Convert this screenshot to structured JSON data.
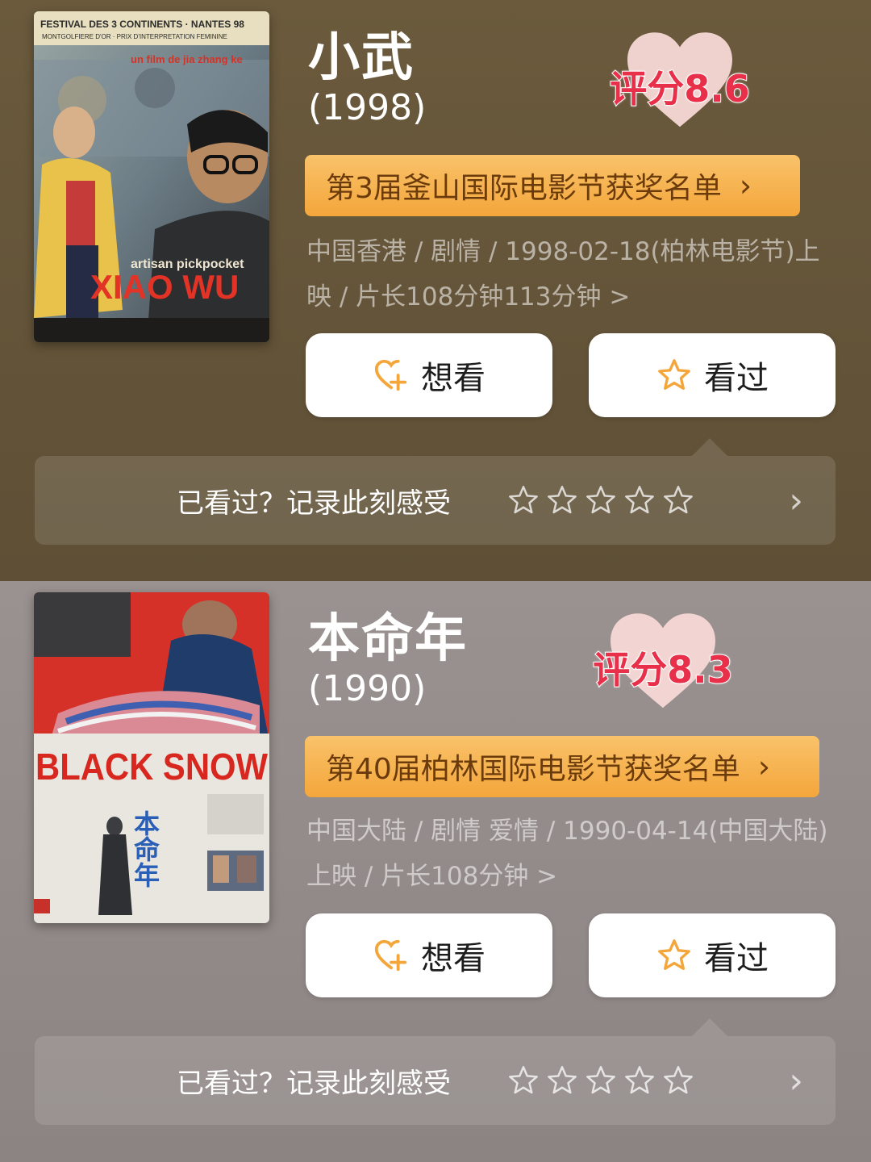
{
  "colors": {
    "accent_orange": "#f4a63b",
    "rating_red": "#e8304a",
    "heart_pink": "#f7d9d6"
  },
  "movies": [
    {
      "title": "小武",
      "year": "(1998)",
      "rating": "评分8.6",
      "award": "第3届釜山国际电影节获奖名单",
      "meta_line1": "中国香港 / 剧情 / 1998-02-18(柏林电影节)上",
      "meta_line2": "映 / 片长108分钟113分钟 >",
      "want_label": "想看",
      "seen_label": "看过",
      "record_label": "已看过？记录此刻感受",
      "star_count": 5,
      "poster": {
        "festival_line1": "FESTIVAL DES 3 CONTINENTS · NANTES 98",
        "festival_line2": "MONTGOLFIERE D'OR · PRIX D'INTERPRETATION FEMININE",
        "credit": "un film de jia zhang ke",
        "subtitle": "artisan pickpocket",
        "big_title": "XIAO WU"
      }
    },
    {
      "title": "本命年",
      "year": "(1990)",
      "rating": "评分8.3",
      "award": "第40届柏林国际电影节获奖名单",
      "meta_line1": "中国大陆 / 剧情 爱情 / 1990-04-14(中国大陆)",
      "meta_line2": "上映 / 片长108分钟 >",
      "want_label": "想看",
      "seen_label": "看过",
      "record_label": "已看过？记录此刻感受",
      "star_count": 5,
      "poster": {
        "big_title": "BLACK SNOW",
        "cn_title": "本命年"
      }
    }
  ]
}
